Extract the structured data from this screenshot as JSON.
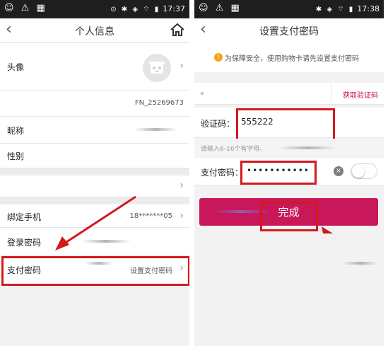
{
  "left_screen": {
    "status_bar": {
      "left_icons": "☺ ⚠ ▦",
      "right_icons": "⊙ ✱ ◈ ⌔ ▮",
      "time": "17:37"
    },
    "nav": {
      "title": "个人信息"
    },
    "rows": {
      "avatar_label": "头像",
      "member_id": "FN_25269673",
      "nickname_label": "昵称",
      "gender_label": "性别",
      "phone_label": "绑定手机",
      "phone_value": "18*******05",
      "login_password_label": "登录密码",
      "pay_password_label": "支付密码",
      "pay_password_value": "设置支付密码"
    }
  },
  "right_screen": {
    "status_bar": {
      "left_icons": "☺ ⚠ ▦",
      "right_icons": "✱ ◈ ⌔ ▮",
      "time": "17:38"
    },
    "nav": {
      "title": "设置支付密码"
    },
    "notice": "为保障安全，使用购物卡请先设置支付密码",
    "get_code_label": "获取验证码",
    "verify_label": "验证码：",
    "verify_value": "555222",
    "hint": "请输入6-16个有字母、",
    "pay_label": "支付密码：",
    "pay_value": "•••••••••••",
    "done_label": "完成"
  },
  "colors": {
    "accent": "#c8185a",
    "highlight": "#d4181c",
    "notice_icon": "#f3a316"
  },
  "icons": [
    "back-icon",
    "home-icon",
    "chevron-right-icon",
    "warning-icon",
    "clear-icon",
    "toggle-switch"
  ]
}
